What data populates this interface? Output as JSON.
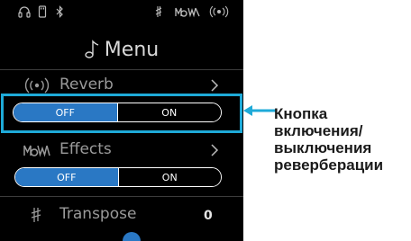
{
  "status_bar": {
    "icons": [
      "headphones-icon",
      "usb-icon",
      "bluetooth-icon",
      "transpose-icon",
      "effects-icon",
      "reverb-icon"
    ]
  },
  "menu": {
    "title": "Menu",
    "title_icon": "music-note-icon",
    "rows": [
      {
        "label": "Reverb",
        "icon": "reverb-icon",
        "has_chevron": true
      },
      {
        "label": "Effects",
        "icon": "effects-icon",
        "has_chevron": true
      },
      {
        "label": "Transpose",
        "icon": "transpose-icon",
        "value": "0"
      }
    ],
    "reverb_toggle": {
      "off_label": "OFF",
      "on_label": "ON",
      "state": "OFF"
    },
    "effects_toggle": {
      "off_label": "OFF",
      "on_label": "ON",
      "state": "OFF"
    }
  },
  "callout": {
    "lines": [
      "Кнопка",
      "включения/",
      "выключения",
      "реверберации"
    ]
  },
  "colors": {
    "screen_bg": "#000000",
    "accent_blue": "#2a78c4",
    "highlight_cyan": "#1eaad8"
  }
}
